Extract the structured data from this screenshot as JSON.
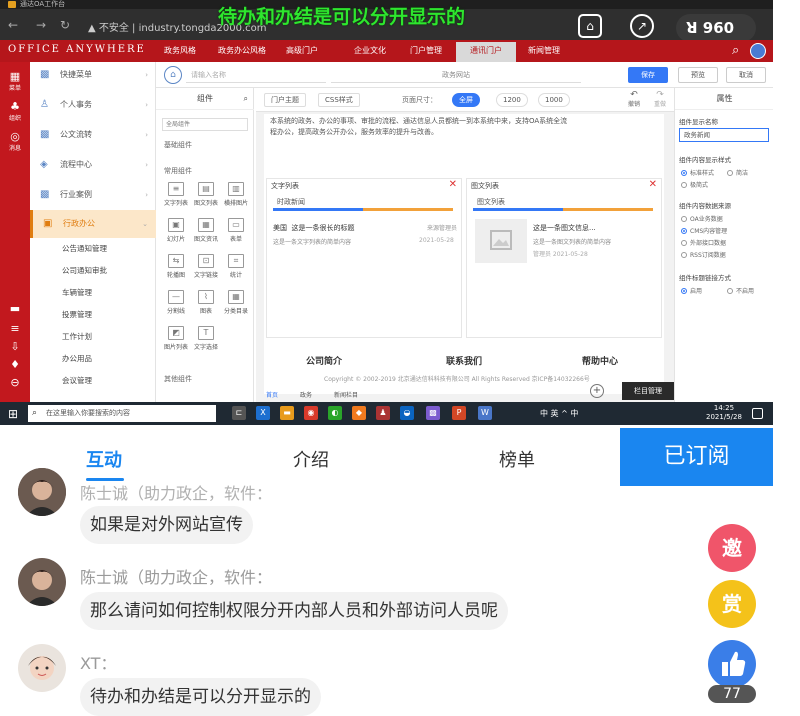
{
  "overlay": {
    "title": "待办和办结是可以分开显示的",
    "viewers_icon": "viewers-icon",
    "viewers": "960"
  },
  "browser": {
    "tab_title": "通达OA工作台",
    "insecure": "▲ 不安全",
    "url": "industry.tongda2000.com"
  },
  "oa": {
    "brand": "OFFICE ANYWHERE",
    "nav": [
      "政务风格",
      "政务办公风格",
      "高级门户",
      "企业文化",
      "门户管理",
      "通讯门户",
      "新闻管理"
    ],
    "nav_active_index": 5,
    "rail": [
      "菜单",
      "组织",
      "消息"
    ],
    "menu": [
      {
        "label": "快捷菜单",
        "icon": "grid-icon"
      },
      {
        "label": "个人事务",
        "icon": "person-icon"
      },
      {
        "label": "公文流转",
        "icon": "grid-icon"
      },
      {
        "label": "流程中心",
        "icon": "flow-icon"
      },
      {
        "label": "行业案例",
        "icon": "grid-icon"
      },
      {
        "label": "行政办公",
        "icon": "briefcase-icon"
      }
    ],
    "submenu": [
      "公告通知管理",
      "公司通知审批",
      "车辆管理",
      "投票管理",
      "工作计划",
      "办公用品",
      "会议管理"
    ]
  },
  "editor": {
    "page_name_placeholder": "请输入名称",
    "page_title": "政务网站",
    "save": "保存",
    "preview": "预览",
    "cancel": "取消",
    "components": "组件",
    "component_select": "全局组件",
    "group_basic": "基础组件",
    "group_common": "常用组件",
    "group_misc": "其他组件",
    "component_items": [
      "文字列表",
      "图文列表",
      "横排图片",
      "幻灯片",
      "图文资讯",
      "表单",
      "轮播图",
      "文字链接",
      "统计",
      "分割线",
      "图表",
      "分类目录",
      "图片列表",
      "文字选择"
    ],
    "canvas_buttons": [
      "门户主题",
      "CSS样式"
    ],
    "page_size_label": "页面尺寸：",
    "page_sizes": [
      "全屏",
      "1200",
      "1000"
    ],
    "undo": "撤销",
    "redo": "重做",
    "description": "本系统的政务、办公的事项、审批的流程、通达信息人员都统一到本系统中来，支持OA系统全流程办公，提高政务公开办公，服务效率的提升与改善。",
    "panel1": {
      "title": "文字列表",
      "tab": "时政新闻",
      "item_title": "这是一条很长的标题",
      "item_prefix": "美国",
      "item_source": "来源管理员",
      "item_desc": "这是一条文字列表的简单内容",
      "item_date": "2021-05-28"
    },
    "panel2": {
      "title": "图文列表",
      "tab": "图文列表",
      "item_title": "这是一条图文信息...",
      "item_desc": "这是一条图文列表的简单内容",
      "item_meta": "管理员 2021-05-28"
    },
    "footer_links": [
      "公司简介",
      "联系我们",
      "帮助中心"
    ],
    "copyright": "Copyright © 2002-2019 北京通达信科科技有限公司 All Rights Reserved 京ICP备14032266号",
    "column_manager": "栏目管理",
    "bottom_tabs": [
      "首页",
      "政务",
      "新闻栏目"
    ],
    "props_title": "属性",
    "props": {
      "name_label": "组件显示名称",
      "name_value": "政务新闻",
      "show_style_label": "组件内容显示样式",
      "show_style_opts": [
        "标准样式",
        "简洁",
        "极简式"
      ],
      "source_label": "组件内容数据来源",
      "source_opts": [
        "OA业务数据",
        "CMS内容管理",
        "外部接口数据",
        "RSS订阅数据"
      ],
      "link_label": "组件标题链接方式",
      "link_opts": [
        "启用",
        "不启用"
      ]
    }
  },
  "taskbar": {
    "search_placeholder": "在这里输入你要搜索的内容",
    "tray": "中 英 ^ 中",
    "time": "14:25",
    "date": "2021/5/28"
  },
  "app": {
    "tabs": [
      "互动",
      "介绍",
      "榜单"
    ],
    "active_tab": 0,
    "subscribe": "已订阅"
  },
  "chat": [
    {
      "name": "陈士诚（助力政企，软件：",
      "message": "如果是对外网站宣传"
    },
    {
      "name": "陈士诚（助力政企，软件：",
      "message": "那么请问如何控制权限分开内部人员和外部访问人员呢"
    },
    {
      "name": "XT：",
      "message": "待办和办结是可以分开显示的"
    }
  ],
  "float_buttons": {
    "invite": "邀",
    "reward": "赏",
    "like_icon": "thumbs-up-icon",
    "like_count": "77"
  },
  "colors": {
    "oa_red": "#b5161b",
    "accent_blue": "#1a86f0",
    "overlay_green": "#2ee62e"
  }
}
